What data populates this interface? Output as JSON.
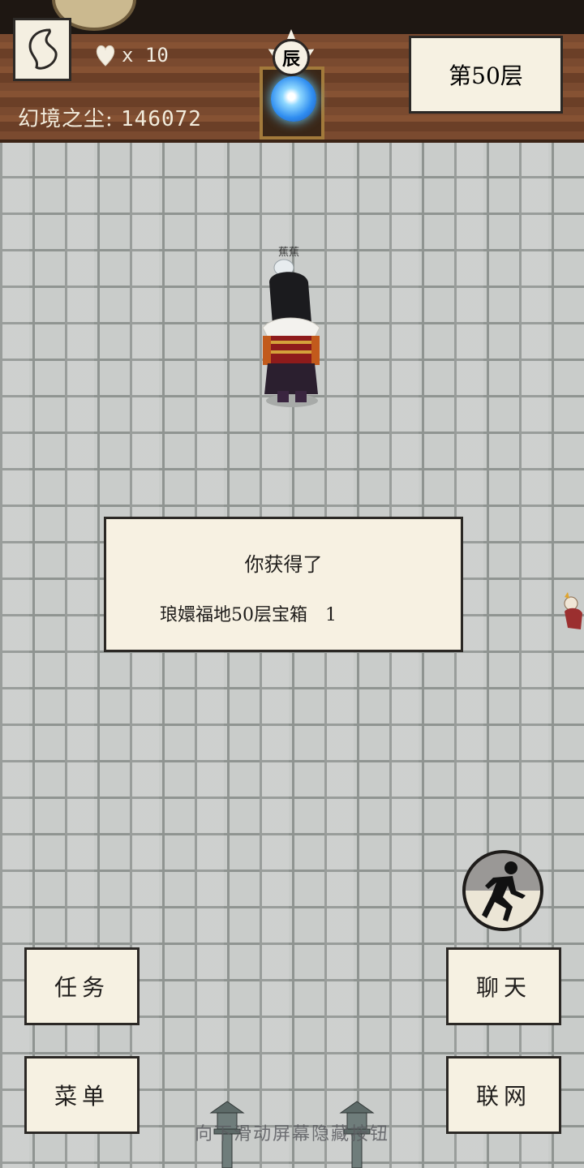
{
  "hud": {
    "lives_count": "x 10",
    "dust_label": "幻境之尘:",
    "dust_value": "146072",
    "zodiac_char": "辰",
    "floor_label": "第50层"
  },
  "player": {
    "name": "蕉蕉"
  },
  "dialog": {
    "title": "你获得了",
    "item_name": "琅嬛福地50层宝箱",
    "item_qty": "1"
  },
  "buttons": {
    "quest": "任务",
    "menu": "菜单",
    "chat": "聊天",
    "network": "联网"
  },
  "hint": "向下滑动屏幕隐藏按钮",
  "colors": {
    "wood": "#7a4a2f",
    "paper": "#f6f1e2",
    "ink": "#2b2825",
    "brick": "#c9ccca"
  },
  "icons": {
    "back": "back-swirl-icon",
    "lives": "heart-icon",
    "sprint": "running-man-icon"
  }
}
